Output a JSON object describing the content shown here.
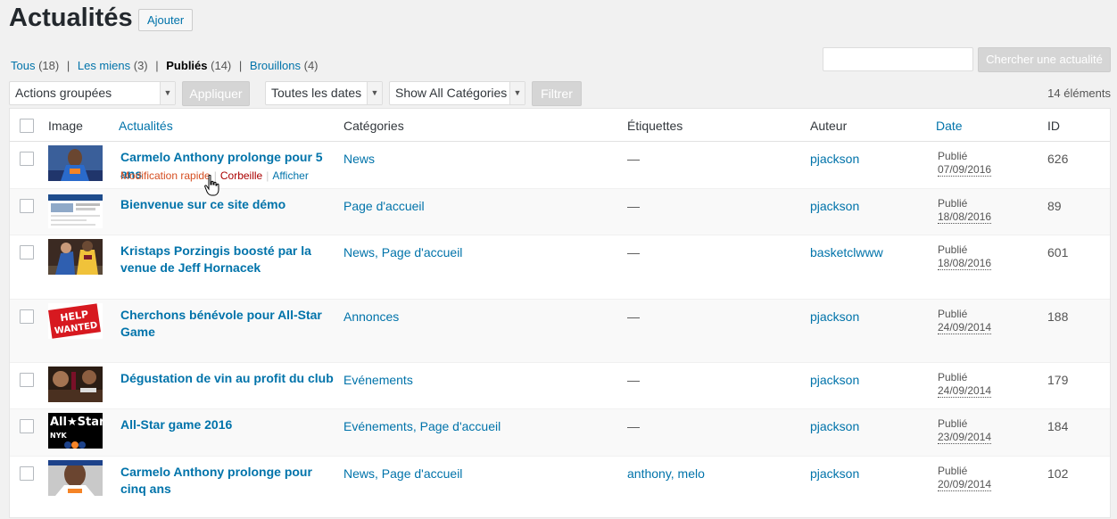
{
  "header": {
    "title": "Actualités",
    "add_label": "Ajouter"
  },
  "filters": {
    "all": {
      "label": "Tous",
      "count": "(18)"
    },
    "mine": {
      "label": "Les miens",
      "count": "(3)"
    },
    "published": {
      "label": "Publiés",
      "count": "(14)"
    },
    "drafts": {
      "label": "Brouillons",
      "count": "(4)"
    }
  },
  "search": {
    "value": "",
    "button": "Chercher une actualité"
  },
  "tablenav": {
    "bulk_actions": "Actions groupées",
    "apply": "Appliquer",
    "dates": "Toutes les dates",
    "categories": "Show All Catégories",
    "filter": "Filtrer",
    "items_count": "14 éléments"
  },
  "columns": {
    "image": "Image",
    "title": "Actualités",
    "categories": "Catégories",
    "tags": "Étiquettes",
    "author": "Auteur",
    "date": "Date",
    "id": "ID"
  },
  "row_actions": {
    "edit": "Modification rapide",
    "trash": "Corbeille",
    "view": "Afficher"
  },
  "rows": [
    {
      "title": "Carmelo Anthony prolonge pour 5 ans",
      "categories": "News",
      "tags": "—",
      "author": "pjackson",
      "status": "Publié",
      "date": "07/09/2016",
      "id": "626",
      "thumb": "blue-jersey"
    },
    {
      "title": "Bienvenue sur ce site démo",
      "categories": "Page d'accueil",
      "tags": "—",
      "author": "pjackson",
      "status": "Publié",
      "date": "18/08/2016",
      "id": "89",
      "thumb": "website"
    },
    {
      "title": "Kristaps Porzingis boosté par la venue de Jeff Hornacek",
      "categories": "News, Page d'accueil",
      "tags": "—",
      "author": "basketclwww",
      "status": "Publié",
      "date": "18/08/2016",
      "id": "601",
      "thumb": "game-action"
    },
    {
      "title": "Cherchons bénévole pour All-Star Game",
      "categories": "Annonces",
      "tags": "—",
      "author": "pjackson",
      "status": "Publié",
      "date": "24/09/2014",
      "id": "188",
      "thumb": "help-wanted"
    },
    {
      "title": "Dégustation de vin au profit du club",
      "categories": "Evénements",
      "tags": "—",
      "author": "pjackson",
      "status": "Publié",
      "date": "24/09/2014",
      "id": "179",
      "thumb": "wine"
    },
    {
      "title": "All-Star game 2016",
      "categories": "Evénements, Page d'accueil",
      "tags": "—",
      "author": "pjackson",
      "status": "Publié",
      "date": "23/09/2014",
      "id": "184",
      "thumb": "all-star"
    },
    {
      "title": "Carmelo Anthony prolonge pour cinq ans",
      "categories": "News, Page d'accueil",
      "tags": "anthony, melo",
      "author": "pjackson",
      "status": "Publié",
      "date": "20/09/2014",
      "id": "102",
      "thumb": "player-portrait"
    }
  ],
  "thumb_text": {
    "help": "HELP",
    "wanted": "WANTED",
    "allstar": "All★Star",
    "nyk": "NYK"
  },
  "colors": {
    "link": "#0073aa",
    "edit": "#d54e21",
    "trash": "#a00000",
    "disabled": "#d5d5d5"
  }
}
